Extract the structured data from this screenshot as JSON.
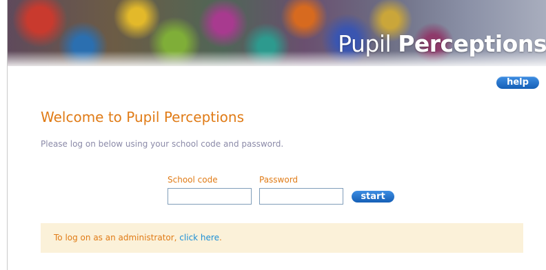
{
  "header": {
    "brand_part1": "Pupil ",
    "brand_part2": "Perceptions"
  },
  "help_label": "help",
  "main": {
    "title": "Welcome to Pupil Perceptions",
    "intro": "Please log on below using your school code and password."
  },
  "form": {
    "school_code_label": "School code",
    "school_code_value": "",
    "password_label": "Password",
    "password_value": "",
    "start_label": "start"
  },
  "admin": {
    "text": "To log on as an administrator, ",
    "link_text": "click here",
    "suffix": "."
  },
  "colors": {
    "accent_orange": "#e07b16",
    "button_blue": "#1f6fc9",
    "link_blue": "#1c8fd6",
    "notice_bg": "#fbf1d9"
  }
}
